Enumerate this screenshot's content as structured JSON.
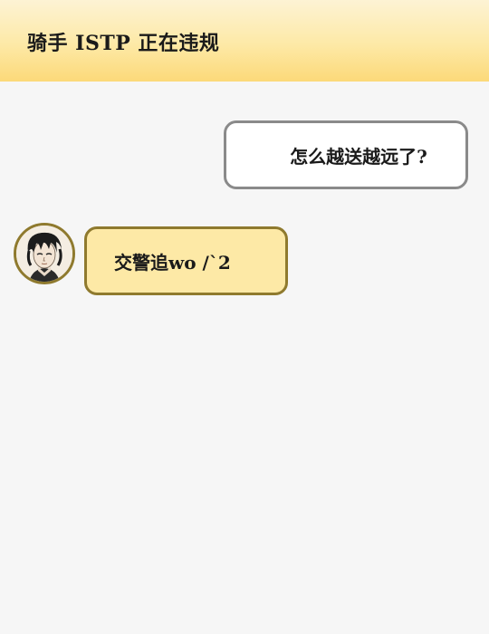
{
  "header": {
    "title": "骑手 ISTP 正在违规"
  },
  "messages": [
    {
      "side": "outgoing",
      "text": "怎么越送越远了?"
    },
    {
      "side": "incoming",
      "text": "交警追wo /`2",
      "avatar": "character-avatar"
    }
  ],
  "colors": {
    "header_gradient_top": "#fdf3d4",
    "header_gradient_bottom": "#fcd979",
    "incoming_bubble": "#fde9a6",
    "incoming_border": "#8f7a2e",
    "outgoing_bubble": "#ffffff",
    "outgoing_border": "#8a8a8a",
    "background": "#f6f6f6"
  }
}
